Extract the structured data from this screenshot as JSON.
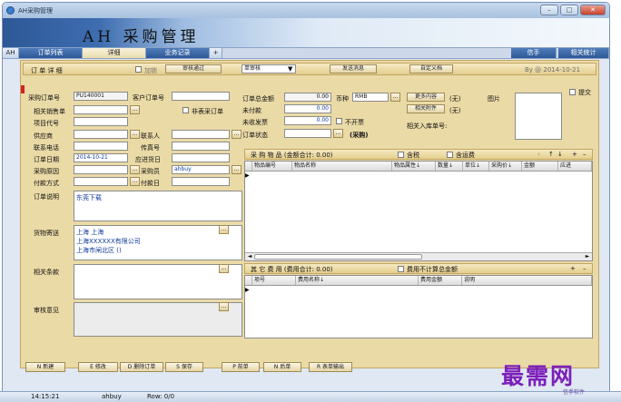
{
  "window": {
    "title": "AH采购管理",
    "minimize": "–",
    "maximize": "□",
    "close": "✕"
  },
  "banner": {
    "app_title": "AH 采购管理"
  },
  "tabs": [
    {
      "label": "AH"
    },
    {
      "label": "订单列表"
    },
    {
      "label": "详细"
    },
    {
      "label": "业务记录"
    },
    {
      "label": "+"
    }
  ],
  "tabs_right": [
    {
      "label": "信手"
    },
    {
      "label": "相关统计"
    }
  ],
  "order": {
    "section_title": "订 单 详 细",
    "lock_label": "加锁",
    "review_pass_label": "审核通过",
    "review_select": "单审核",
    "send_message_label": "发送消息",
    "custom_doc_label": "自定义档",
    "by_text": "By  @ 2014-10-21",
    "order_no_label": "采购订单号",
    "order_no": "PU140001",
    "customer_order_no_label": "客户订单号",
    "related_sales_label": "相关销售单",
    "non_purchase_label": "非表采订单",
    "project_code_label": "项目代号",
    "supplier_label": "供应商",
    "contact_label": "联系人",
    "phone_label": "联系电话",
    "fax_label": "传真号",
    "order_date_label": "订单日期",
    "order_date": "2014-10-21",
    "due_date_label": "应进货日",
    "reason_label": "采购原因",
    "buyer_label": "采购员",
    "buyer": "ahbuy",
    "pay_method_label": "付款方式",
    "pay_date_label": "付款日",
    "note_label": "订单说明",
    "note_value": "东莞下载",
    "delivery_label": "货物寄送",
    "delivery_lines": [
      "上海 上海",
      "上海XXXXXX有限公司",
      "上海市闸北区 ()"
    ],
    "terms_label": "相关条款",
    "opinion_label": "审核意见",
    "total_label": "订单总金额",
    "total_value": "0.00",
    "currency_label": "币种",
    "currency_value": "RMB",
    "unpaid_label": "未付款",
    "unpaid_value": "0.00",
    "uninvoiced_label": "未收发票",
    "uninvoiced_value": "0.00",
    "no_invoice_label": "不开票",
    "status_label": "订单状态",
    "status_value": "(采购)",
    "more_content_label": "更多内容",
    "more_content_none": "(无)",
    "attachment_label": "相关附件",
    "attachment_none": "(无)",
    "picture_label": "图片",
    "reminder_label": "提交",
    "related_in_label": "相关入库单号:"
  },
  "items": {
    "title": "采 购 物 品  (金额合计: 0.00)",
    "tax_label": "含税",
    "freight_label": "含运费",
    "toolbar_symbols": [
      "‹",
      "↑",
      "↓",
      "+",
      "–"
    ],
    "columns": [
      "物品编号",
      "物品名称",
      "物品属性↓",
      "数量↓",
      "单位↓",
      "采购价↓",
      "金额",
      "应进"
    ]
  },
  "fees": {
    "title": "其 它 费 用  (费用合计: 0.00)",
    "exclude_label": "费用不计算总金额",
    "toolbar_symbols": [
      "+",
      "–"
    ],
    "columns": [
      "项号",
      "费用名称↓",
      "费用金额",
      "说明"
    ]
  },
  "bottom_toolbar": [
    {
      "label": "N 新建"
    },
    {
      "label": "E 修改"
    },
    {
      "label": "D 删除订单"
    },
    {
      "label": "S 保存"
    },
    {
      "label": "P 前单"
    },
    {
      "label": "N 后单"
    },
    {
      "label": "R 表单输出"
    }
  ],
  "statusbar": {
    "time": "14:15:21",
    "user": "ahbuy",
    "row": "Row: 0/0"
  },
  "watermark": {
    "text": "最需网",
    "sub": "信手软件"
  },
  "colors": {
    "panel": "#eadaa6",
    "tab_active": "#ebdcae",
    "banner": "#2d5896",
    "watermark": "#7d1fbb"
  }
}
